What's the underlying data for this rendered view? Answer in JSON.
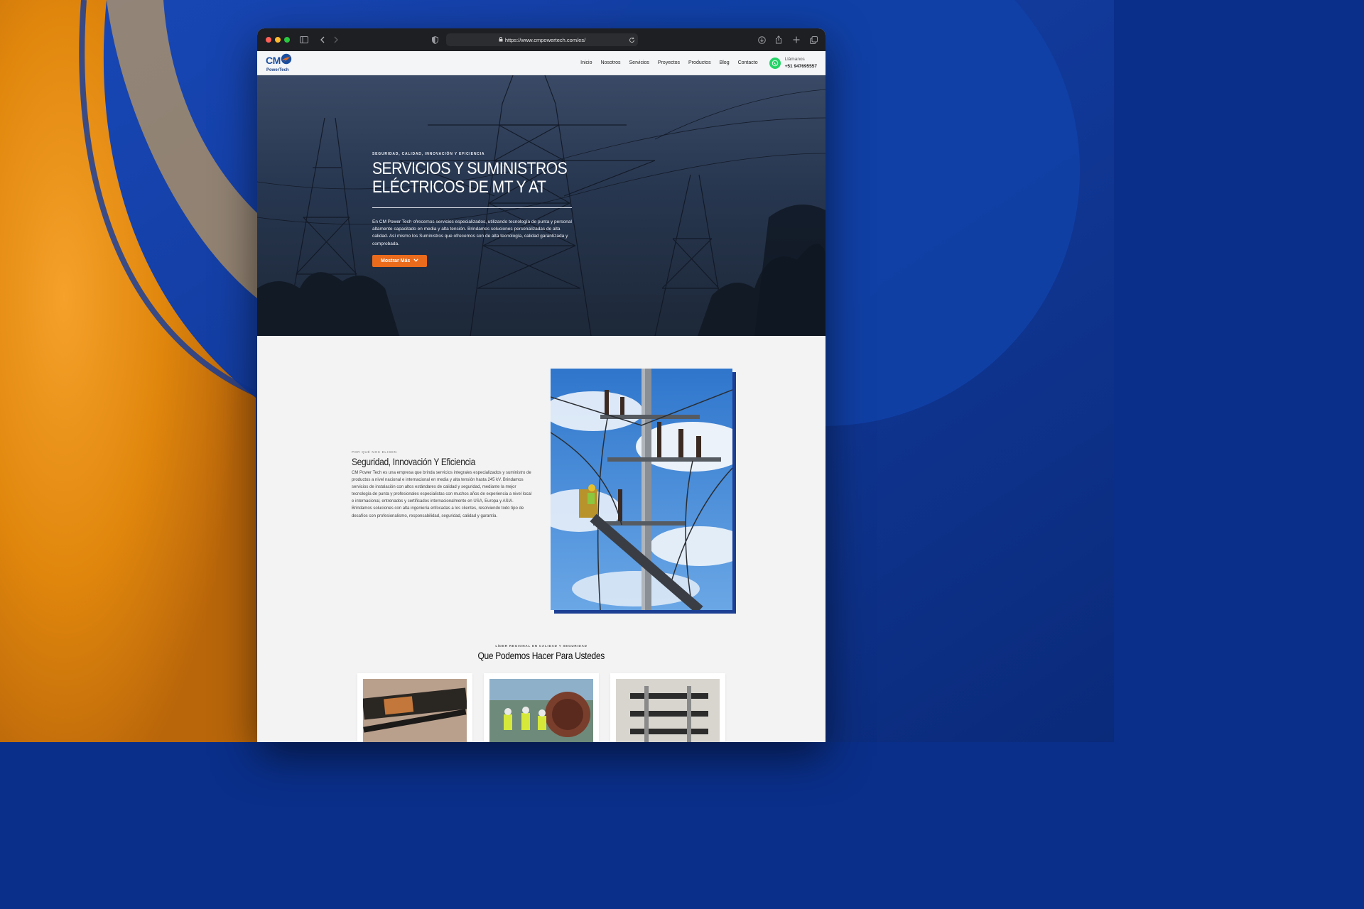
{
  "browser": {
    "url": "https://www.cmpowertech.com/es/"
  },
  "site": {
    "logo": {
      "brand": "CM",
      "sub": "PowerTech"
    },
    "nav": [
      "Inicio",
      "Nosotros",
      "Servicios",
      "Proyectos",
      "Productos",
      "Blog",
      "Contacto"
    ],
    "call": {
      "label": "Llámanos",
      "phone": "+51 947695557"
    }
  },
  "hero": {
    "eyebrow": "SEGURIDAD, CALIDAD, INNOVACIÓN Y EFICIENCIA",
    "title_line1": "SERVICIOS Y SUMINISTROS",
    "title_line2": "ELÉCTRICOS DE MT Y AT",
    "description": "En CM Power Tech ofrecemos servicios especializados, utilizando tecnología de punta y personal altamente capacitado en media y alta tensión. Brindamos soluciones personalizadas de alta calidad. Así mismo los Suministros que ofrecemos son de alta tecnología, calidad garantizada y comprobada.",
    "button": "Mostrar Más"
  },
  "about": {
    "eyebrow": "POR QUÉ NOS ELIGEN",
    "title": "Seguridad, Innovación Y Eficiencia",
    "paragraph1": "CM Power Tech es una empresa que brinda servicios integrales especializados y suministro de productos a nivel nacional e internacional en media y alta tensión hasta 245 kV. Brindamos servicios de instalación con altos estándares de calidad y seguridad, mediante la mejor tecnología de punta y profesionales especialistas con muchos años de experiencia a nivel local e internacional, entrenados y certificados internacionalmente en USA, Europa y ASIA.",
    "paragraph2": "Brindamos soluciones con alta ingeniería enfocadas a los clientes, resolviendo todo tipo de desafíos con profesionalismo, responsabilidad, seguridad, calidad y garantía."
  },
  "services": {
    "eyebrow": "LÍDER REGIONAL EN CALIDAD Y SEGURIDAD",
    "title": "Que Podemos Hacer Para Ustedes"
  },
  "colors": {
    "accent": "#ea6b1c",
    "brand_blue": "#1a4fa0",
    "whatsapp": "#25d366"
  }
}
